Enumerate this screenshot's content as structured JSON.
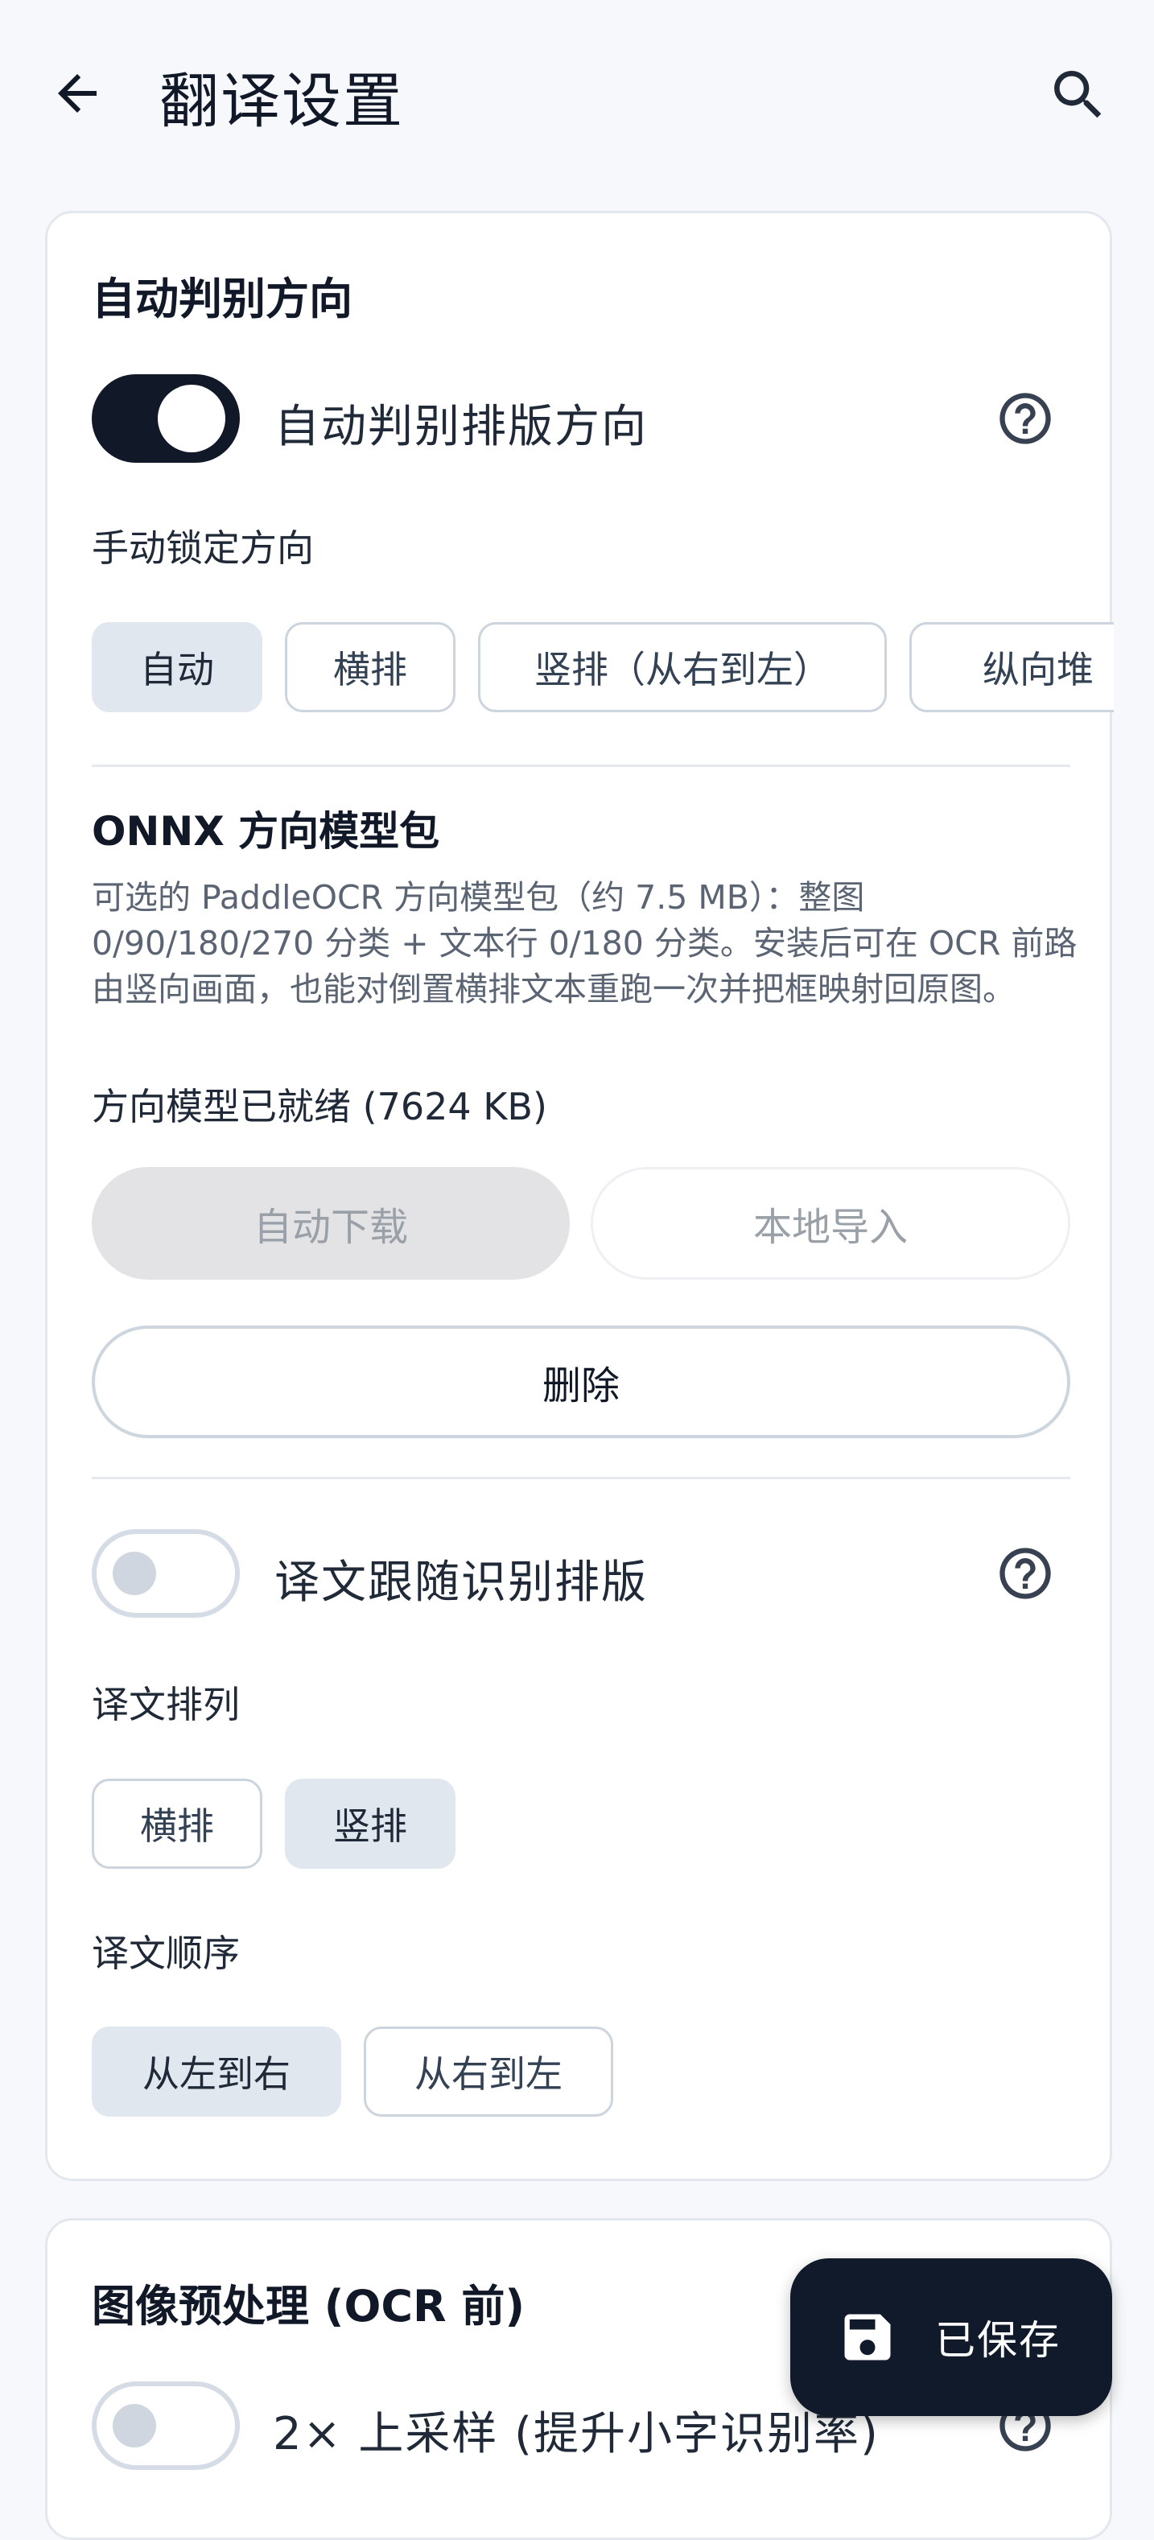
{
  "app_bar": {
    "title": "翻译设置",
    "back_icon": "arrow-back-icon",
    "search_icon": "search-icon"
  },
  "colors": {
    "primary": "#111827",
    "background": "#f6f8fb",
    "chip_selected": "#e1e7ef",
    "border": "#ccd4de"
  },
  "auto_direction": {
    "title": "自动判别方向",
    "auto_detect_toggle": {
      "label": "自动判别排版方向",
      "on": true
    },
    "manual_lock": {
      "label": "手动锁定方向",
      "options": [
        "自动",
        "横排",
        "竖排（从右到左）",
        "纵向堆"
      ],
      "selected": "自动"
    },
    "onnx": {
      "title": "ONNX 方向模型包",
      "description": "可选的 PaddleOCR 方向模型包（约 7.5 MB）：整图 0/90/180/270 分类 + 文本行 0/180 分类。安装后可在 OCR 前路由竖向画面，也能对倒置横排文本重跑一次并把框映射回原图。",
      "status": "方向模型已就绪 (7624 KB)",
      "auto_download": "自动下载",
      "local_import": "本地导入",
      "delete": "删除"
    },
    "follow_layout_toggle": {
      "label": "译文跟随识别排版",
      "on": false
    },
    "translation_arrangement": {
      "label": "译文排列",
      "options": [
        "横排",
        "竖排"
      ],
      "selected": "竖排"
    },
    "translation_order": {
      "label": "译文顺序",
      "options": [
        "从左到右",
        "从右到左"
      ],
      "selected": "从左到右"
    }
  },
  "image_preprocessing": {
    "title": "图像预处理 (OCR 前)",
    "upscale_toggle": {
      "label": "2× 上采样 (提升小字识别率)",
      "on": false
    }
  },
  "fab": {
    "label": "已保存",
    "icon": "save-icon"
  }
}
